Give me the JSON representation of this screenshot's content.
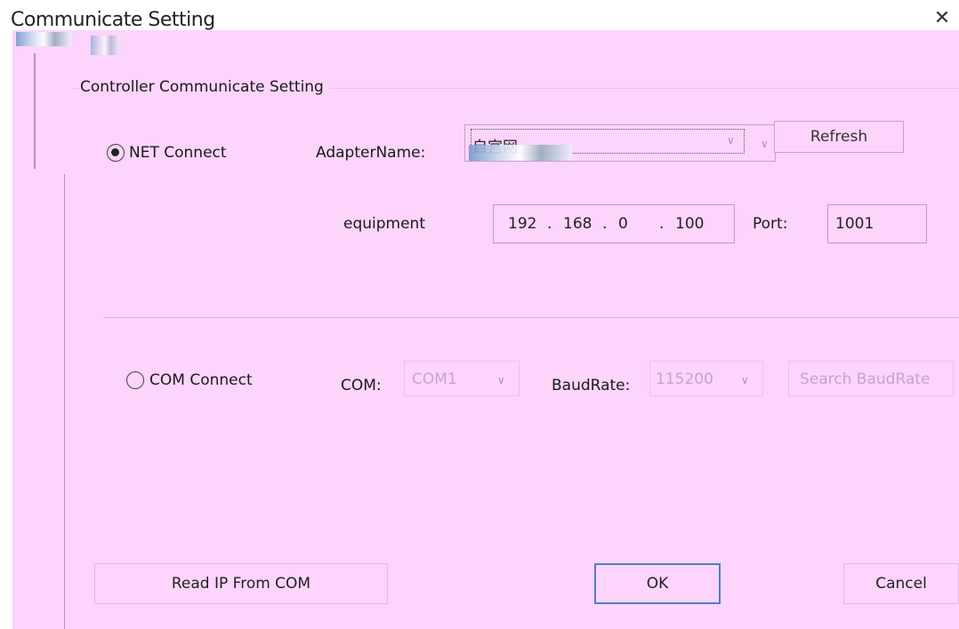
{
  "window": {
    "title": "Communicate Setting",
    "close_glyph": "✕"
  },
  "group": {
    "label": "Controller Communicate Setting"
  },
  "net": {
    "radio_label": "NET Connect",
    "checked": true,
    "adapter_label": "AdapterName:",
    "adapter_value": "自宫网",
    "refresh_label": "Refresh",
    "equipment_label": "equipment",
    "ip": [
      "192",
      "168",
      "0",
      "100"
    ],
    "port_label": "Port:",
    "port_value": "1001"
  },
  "com": {
    "radio_label": "COM Connect",
    "checked": false,
    "com_label": "COM:",
    "com_value": "COM1",
    "baud_label": "BaudRate:",
    "baud_value": "115200",
    "search_label": "Search BaudRate"
  },
  "buttons": {
    "read_ip": "Read IP From COM",
    "ok": "OK",
    "cancel": "Cancel"
  },
  "colors": {
    "background": "#fcd4fc",
    "default_button_border": "#4f7fbf",
    "disabled_text": "#c9a3c9"
  }
}
